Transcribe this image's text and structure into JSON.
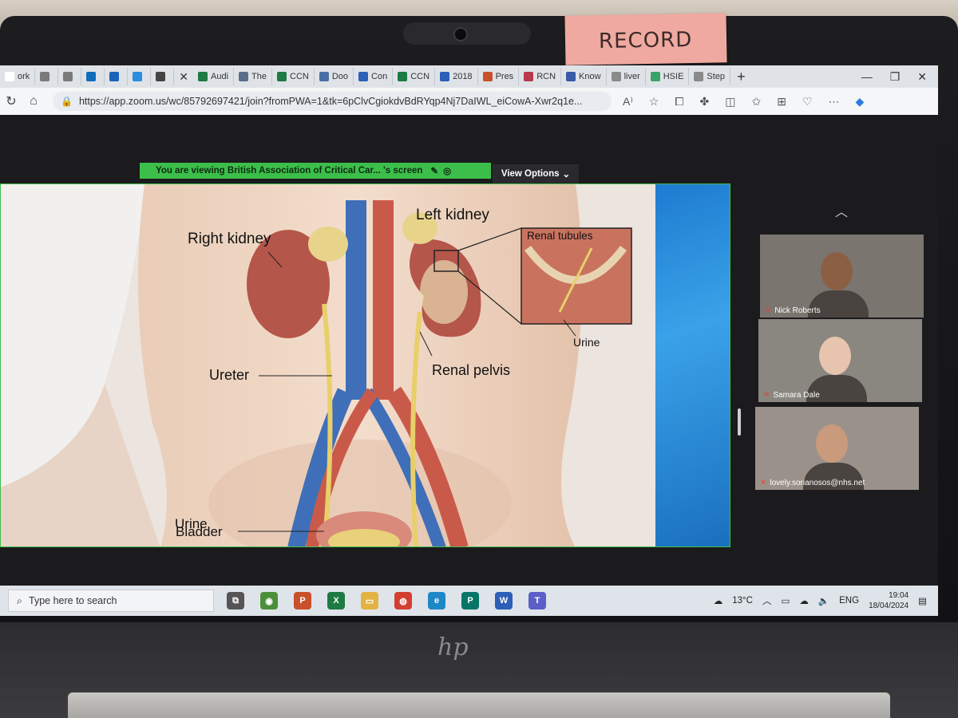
{
  "sticky_note": "RECORD",
  "browser": {
    "tabs": [
      {
        "label": "ork",
        "color": "#ffffff"
      },
      {
        "label": "",
        "color": "#7a7a7a"
      },
      {
        "label": "",
        "color": "#7a7a7a"
      },
      {
        "label": "",
        "color": "#0f6cbd"
      },
      {
        "label": "",
        "color": "#1a63b8"
      },
      {
        "label": "",
        "color": "#2a8de0"
      },
      {
        "label": "",
        "color": "#444444"
      },
      {
        "label": "Audi",
        "color": "#1d7a43"
      },
      {
        "label": "The",
        "color": "#5b6d8a"
      },
      {
        "label": "CCN",
        "color": "#1d7a43"
      },
      {
        "label": "Doo",
        "color": "#4a6fa5"
      },
      {
        "label": "Con",
        "color": "#2b5fb8"
      },
      {
        "label": "CCN",
        "color": "#1d7a43"
      },
      {
        "label": "2018",
        "color": "#2b5fb8"
      },
      {
        "label": "Pres",
        "color": "#c8502a"
      },
      {
        "label": "RCN",
        "color": "#b8384e"
      },
      {
        "label": "Know",
        "color": "#3a5aa8"
      },
      {
        "label": "liver",
        "color": "#8a8a8a"
      },
      {
        "label": "HSIE",
        "color": "#3aa36a"
      },
      {
        "label": "Step",
        "color": "#8a8a8a"
      }
    ],
    "tab_plus": "+",
    "url": "https://app.zoom.us/wc/85792697421/join?fromPWA=1&tk=6pClvCgiokdvBdRYqp4Nj7DaIWL_eiCowA-Xwr2q1e..."
  },
  "zoom": {
    "share_banner": "You are viewing  British Association of Critical Car...  's screen",
    "view_options": "View Options",
    "slide_labels": {
      "right_kidney": "Right kidney",
      "left_kidney": "Left kidney",
      "renal_tubules": "Renal tubules",
      "urine_inset": "Urine",
      "ureter": "Ureter",
      "renal_pelvis": "Renal pelvis",
      "bladder": "Bladder",
      "urine_bottom": "Urine"
    },
    "participants": [
      {
        "name": "Nick Roberts",
        "bg": "#7b7570",
        "skin": "#8a5f44"
      },
      {
        "name": "Samara Dale",
        "bg": "#8a8680",
        "skin": "#e6c4ae"
      },
      {
        "name": "lovely.sorianosos@nhs.net",
        "bg": "#9a928a",
        "skin": "#c99a7c"
      }
    ]
  },
  "taskbar": {
    "search_placeholder": "Type here to search",
    "apps": [
      {
        "name": "task-view",
        "color": "#555555",
        "glyph": "⧉"
      },
      {
        "name": "app-green",
        "color": "#4c8f3a",
        "glyph": "◉"
      },
      {
        "name": "powerpoint",
        "color": "#c8502a",
        "glyph": "P"
      },
      {
        "name": "excel",
        "color": "#1d7a43",
        "glyph": "X"
      },
      {
        "name": "file-explorer",
        "color": "#e3b341",
        "glyph": "▭"
      },
      {
        "name": "chrome",
        "color": "#d23f31",
        "glyph": "◍"
      },
      {
        "name": "edge",
        "color": "#1e88c7",
        "glyph": "e"
      },
      {
        "name": "publisher",
        "color": "#077568",
        "glyph": "P"
      },
      {
        "name": "word",
        "color": "#2b5fb8",
        "glyph": "W"
      },
      {
        "name": "teams",
        "color": "#5b5fc7",
        "glyph": "T"
      }
    ],
    "weather": "13°C",
    "language": "ENG",
    "time": "19:04",
    "date": "18/04/2024"
  }
}
